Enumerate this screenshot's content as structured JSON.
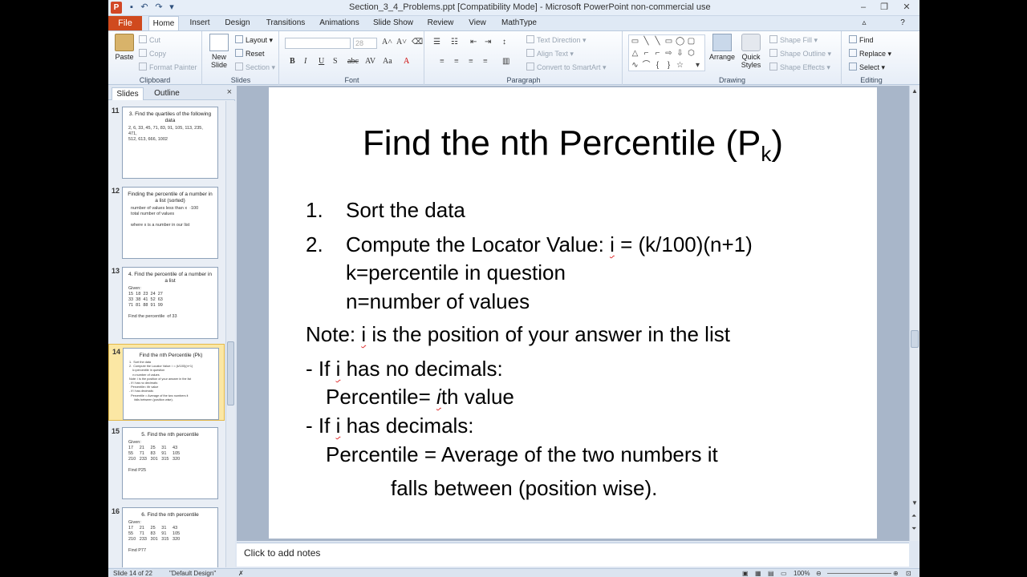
{
  "window": {
    "title": "Section_3_4_Problems.ppt [Compatibility Mode] - Microsoft PowerPoint non-commercial use",
    "app_icon": "P"
  },
  "tabs": [
    "File",
    "Home",
    "Insert",
    "Design",
    "Transitions",
    "Animations",
    "Slide Show",
    "Review",
    "View",
    "MathType"
  ],
  "ribbon": {
    "clipboard": {
      "paste": "Paste",
      "cut": "Cut",
      "copy": "Copy",
      "format_painter": "Format Painter",
      "label": "Clipboard"
    },
    "slides": {
      "new_slide": "New Slide",
      "layout": "Layout",
      "reset": "Reset",
      "section": "Section",
      "label": "Slides"
    },
    "font": {
      "size": "28",
      "label": "Font"
    },
    "paragraph": {
      "text_direction": "Text Direction",
      "align_text": "Align Text",
      "convert_smartart": "Convert to SmartArt",
      "label": "Paragraph"
    },
    "drawing": {
      "arrange": "Arrange",
      "quick_styles": "Quick Styles",
      "shape_fill": "Shape Fill",
      "shape_outline": "Shape Outline",
      "shape_effects": "Shape Effects",
      "label": "Drawing"
    },
    "editing": {
      "find": "Find",
      "replace": "Replace",
      "select": "Select",
      "label": "Editing"
    }
  },
  "panel": {
    "tab_slides": "Slides",
    "tab_outline": "Outline",
    "close": "×",
    "thumbnails": [
      {
        "num": "11",
        "title": "3.  Find the quartiles of the following data",
        "body": "2, 6, 33, 45, 71, 83, 91, 105, 113, 235, 471,\n512, 613, 666, 1002"
      },
      {
        "num": "12",
        "title": "Finding the percentile  of a number in a list (sorted)",
        "body": "  number of values less than x  ·100\n  total number of values\n\n  where x is a number in our list"
      },
      {
        "num": "13",
        "title": "4.  Find the percentile of a number in a list",
        "body": "Given:\n15  18  23  24  27\n33  38  41  52  63\n71  81  88  91  99\n\nFind the percentile  of 33"
      },
      {
        "num": "14",
        "title": "Find the nth Percentile (Pk)",
        "body": "1.  Sort the data\n2.  Compute the Locator Value: i = (k/100)(n+1)\n    k=percentile in question\n    n=number of values\nNote: i is the position of your answer in the list\n- If i has no decimals:\n  Percentile= ith value\n- If i has decimals:\n  Percentile = Average of the two numbers it\n      falls between (position wise)."
      },
      {
        "num": "15",
        "title": "5.  Find the nth percentile",
        "body": "Given:\n17     21     25     31     43\n55     71     83     91     105\n210   233   301   315   320\n\nFind P25"
      },
      {
        "num": "16",
        "title": "6.  Find the nth percentile",
        "body": "Given:\n17     21     25     31     43\n55     71     83     91     105\n210   233   301   315   320\n\nFind P77"
      }
    ]
  },
  "slide": {
    "title_main": "Find the nth Percentile (P",
    "title_sub": "k",
    "title_close": ")",
    "line1_num": "1.",
    "line1": "Sort the data",
    "line2_num": "2.",
    "line2_a": "Compute the Locator Value: ",
    "line2_i": "i",
    "line2_b": " = (k/100)(n+1)",
    "line3": "k=percentile in question",
    "line4": "n=number of values",
    "note_a": "Note: ",
    "note_i": "i",
    "note_b": " is the position of your answer in the list",
    "nodec_a": "- If ",
    "nodec_i": "i",
    "nodec_b": " has no decimals:",
    "pct1_a": "Percentile= ",
    "pct1_i": "i",
    "pct1_b": "th value",
    "dec_a": "- If ",
    "dec_i": "i",
    "dec_b": " has decimals:",
    "pct2": "Percentile = Average of the two numbers it",
    "pct3": "falls between (position wise)."
  },
  "notes": {
    "placeholder": "Click to add notes"
  },
  "status": {
    "slide": "Slide 14 of 22",
    "theme": "\"Default Design\"",
    "zoom": "100%"
  }
}
